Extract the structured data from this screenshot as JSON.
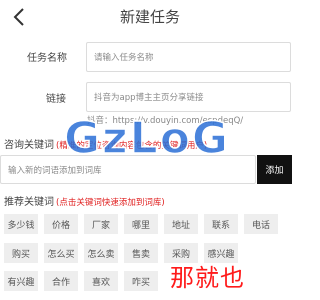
{
  "header": {
    "title": "新建任务",
    "back_icon": "chevron-left-icon"
  },
  "form": {
    "task_name_label": "任务名称",
    "task_name_placeholder": "请输入任务名称",
    "link_label": "链接",
    "link_placeholder": "抖音为app博主主页分享链接",
    "link_hint": "抖音：https://v.douyin.com/espdeqQ/"
  },
  "consult": {
    "title": "咨询关键词",
    "note": "(精准的定位咨询内容包含的关键词用户)",
    "input_placeholder": "输入新的词语添加到词库",
    "add_label": "添加"
  },
  "recommend": {
    "title": "推荐关键词",
    "note": "(点击关键词快速添加到词库)",
    "tags": [
      [
        "多少钱",
        "价格",
        "厂家",
        "哪里",
        "地址",
        "联系",
        "电话"
      ],
      [
        "购买",
        "怎么买",
        "怎么卖",
        "售卖",
        "采购",
        "感兴趣",
        ""
      ],
      [
        "有兴趣",
        "合作",
        "喜欢",
        "咋买",
        "",
        "",
        ""
      ]
    ]
  },
  "watermark": {
    "logo_text": "GzLoG",
    "stamp_text": "那就也",
    "color": "#2a6fd6"
  }
}
